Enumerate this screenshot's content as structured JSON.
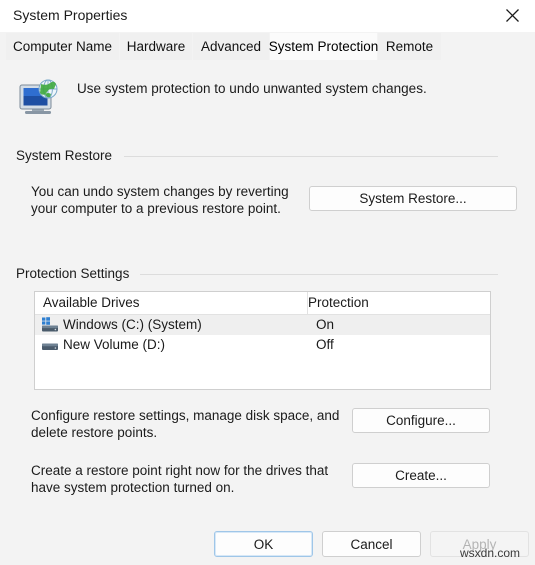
{
  "window": {
    "title": "System Properties",
    "close_icon": "close-icon"
  },
  "tabs": [
    {
      "label": "Computer Name",
      "selected": false
    },
    {
      "label": "Hardware",
      "selected": false
    },
    {
      "label": "Advanced",
      "selected": false
    },
    {
      "label": "System Protection",
      "selected": true
    },
    {
      "label": "Remote",
      "selected": false
    }
  ],
  "header": {
    "icon": "system-protection-icon",
    "text": "Use system protection to undo unwanted system changes."
  },
  "system_restore": {
    "group_label": "System Restore",
    "description_line1": "You can undo system changes by reverting",
    "description_line2": "your computer to a previous restore point.",
    "button_label": "System Restore..."
  },
  "protection_settings": {
    "group_label": "Protection Settings",
    "columns": {
      "drives": "Available Drives",
      "protection": "Protection"
    },
    "rows": [
      {
        "icon": "windows-drive-icon",
        "name": "Windows (C:) (System)",
        "protection": "On",
        "selected": true
      },
      {
        "icon": "hard-drive-icon",
        "name": "New Volume (D:)",
        "protection": "Off",
        "selected": false
      }
    ],
    "configure": {
      "description_line1": "Configure restore settings, manage disk space, and",
      "description_line2": "delete restore points.",
      "button_label": "Configure..."
    },
    "create": {
      "description_line1": "Create a restore point right now for the drives that",
      "description_line2": "have system protection turned on.",
      "button_label": "Create..."
    }
  },
  "footer": {
    "ok_label": "OK",
    "cancel_label": "Cancel",
    "apply_label": "Apply",
    "apply_disabled": true
  },
  "watermark": "wsxdn.com",
  "colors": {
    "dialog_background": "#f3f3f3",
    "titlebar_background": "#ffffff",
    "selected_tab_background": "#fbfbfb",
    "selected_row_background": "#efefef",
    "button_border": "#cfcfcf",
    "default_button_border": "#9fc6e8",
    "disabled_text": "#b4b4b4",
    "text": "#1b1b1b"
  }
}
